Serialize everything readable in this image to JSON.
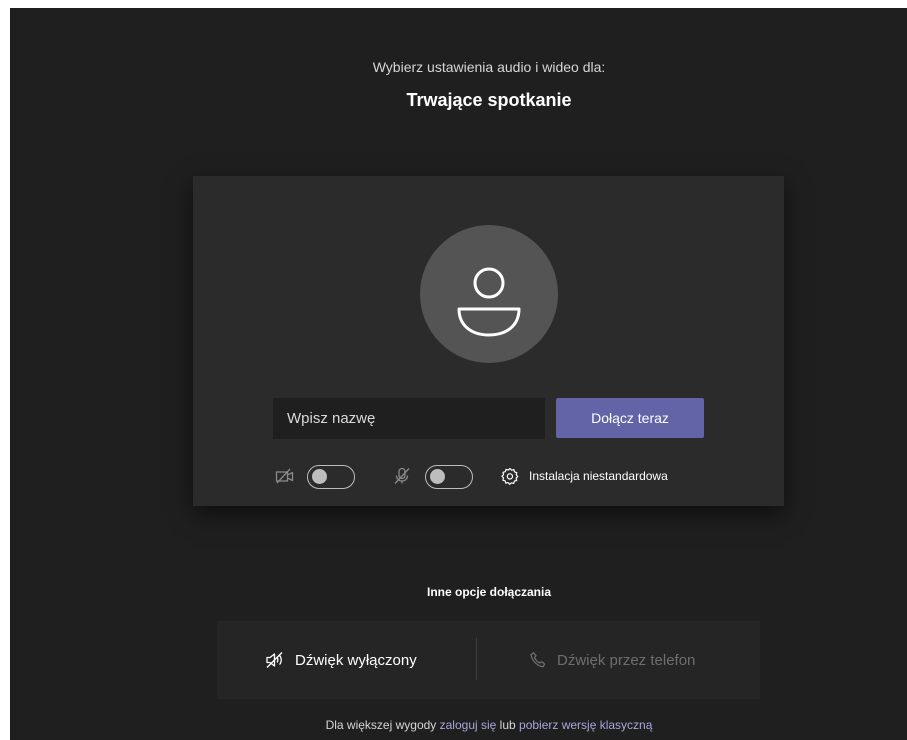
{
  "header": {
    "subtitle": "Wybierz ustawienia audio i wideo dla:",
    "meeting_title": "Trwające spotkanie"
  },
  "prejoin": {
    "avatar_icon": "person-icon",
    "name_placeholder": "Wpisz nazwę",
    "join_label": "Dołącz teraz",
    "camera_icon": "video-off-icon",
    "camera_on": false,
    "mic_icon": "mic-off-icon",
    "mic_on": false,
    "settings_icon": "gear-icon",
    "device_settings_label": "Instalacja niestandardowa"
  },
  "other_options": {
    "title": "Inne opcje dołączania",
    "audio_off_icon": "speaker-off-icon",
    "audio_off_label": "Dźwięk wyłączony",
    "phone_icon": "phone-icon",
    "phone_audio_label": "Dźwięk przez telefon"
  },
  "footer": {
    "prefix": "Dla większej wygody ",
    "sign_in_link": "zaloguj się",
    "middle": " lub ",
    "download_link": "pobierz wersję klasyczną"
  },
  "colors": {
    "background": "#1f1f1f",
    "card": "#2b2b2b",
    "accent": "#6264a7",
    "link": "#a6a7dc"
  }
}
